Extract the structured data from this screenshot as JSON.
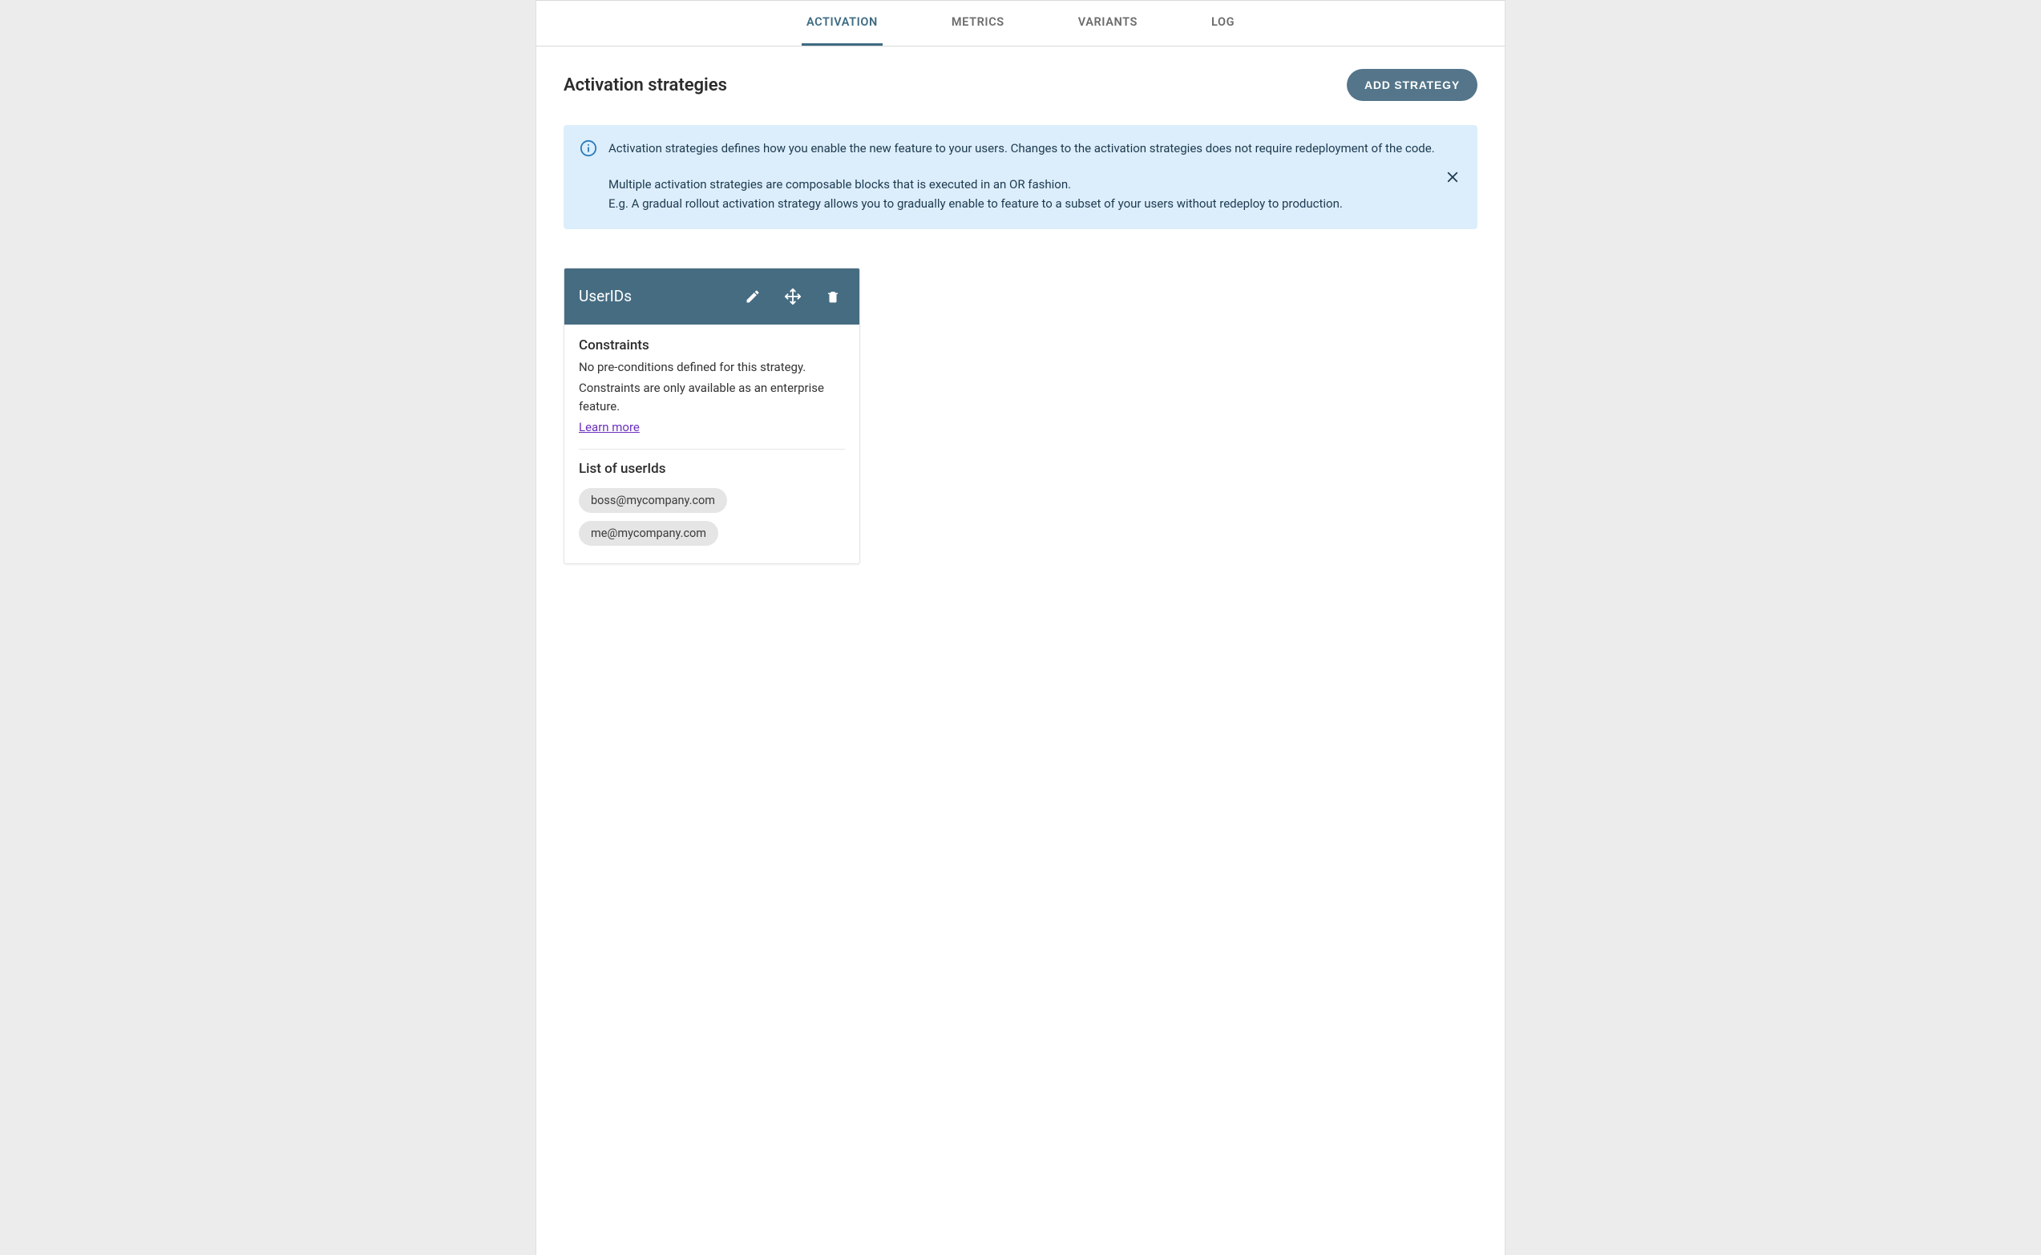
{
  "tabs": [
    {
      "label": "ACTIVATION",
      "active": true
    },
    {
      "label": "METRICS",
      "active": false
    },
    {
      "label": "VARIANTS",
      "active": false
    },
    {
      "label": "LOG",
      "active": false
    }
  ],
  "page_title": "Activation strategies",
  "add_button_label": "ADD STRATEGY",
  "info_alert": {
    "p1": "Activation strategies defines how you enable the new feature to your users. Changes to the activation strategies does not require redeployment of the code.",
    "p2": "Multiple activation strategies are composable blocks that is executed in an OR fashion.",
    "p3": "E.g. A gradual rollout activation strategy allows you to gradually enable to feature to a subset of your users without redeploy to production."
  },
  "strategy_card": {
    "title": "UserIDs",
    "constraints_heading": "Constraints",
    "constraints_none": "No pre-conditions defined for this strategy.",
    "constraints_enterprise": "Constraints are only available as an enterprise feature.",
    "learn_more_label": "Learn more",
    "user_ids_heading": "List of userIds",
    "user_ids": [
      "boss@mycompany.com",
      "me@mycompany.com"
    ]
  },
  "colors": {
    "accent": "#466c82",
    "info_bg": "#dceefb",
    "link_purple": "#6b2fbd"
  }
}
